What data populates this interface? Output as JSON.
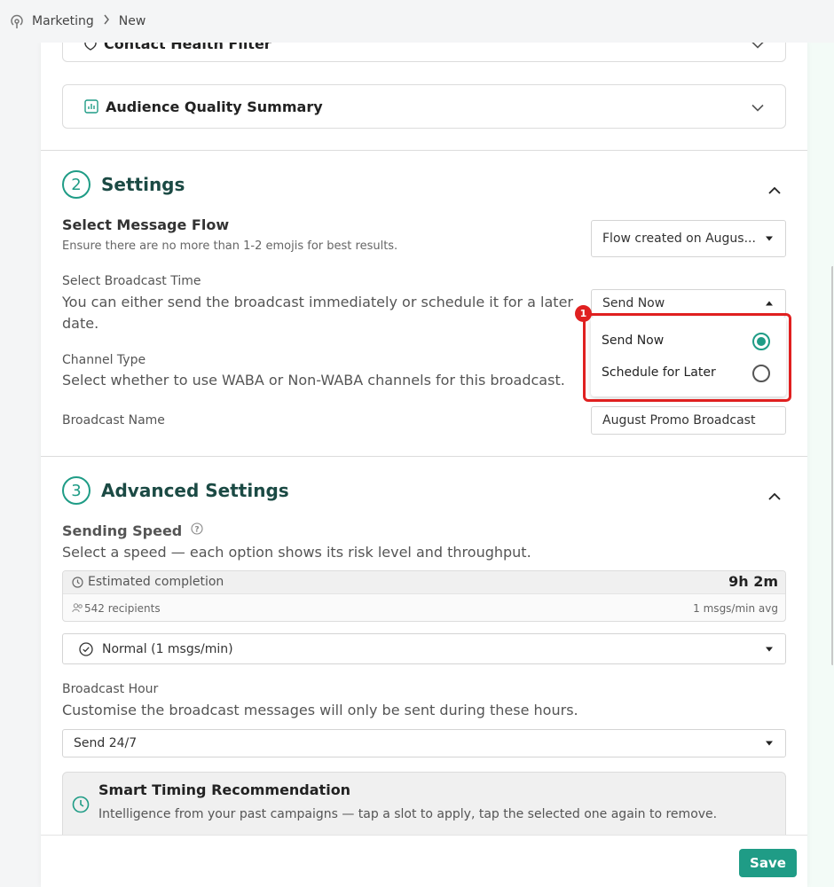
{
  "breadcrumb": {
    "root": "Marketing",
    "current": "New"
  },
  "audience": {
    "contact_health_filter": "Contact Health Filter",
    "audience_quality_summary": "Audience Quality Summary"
  },
  "settings": {
    "step": "2",
    "title": "Settings",
    "message_flow_label": "Select Message Flow",
    "message_flow_desc": "Ensure there are no more than 1-2 emojis for best results.",
    "message_flow_value": "Flow created on Augus...",
    "broadcast_time_label": "Select Broadcast Time",
    "broadcast_time_desc": "You can either send the broadcast immediately or schedule it for a later date.",
    "broadcast_time_value": "Send Now",
    "broadcast_time_options": [
      {
        "label": "Send Now",
        "selected": true
      },
      {
        "label": "Schedule for Later",
        "selected": false
      }
    ],
    "annotation_badge": "1",
    "channel_type_label": "Channel Type",
    "channel_type_desc": "Select whether to use WABA or Non-WABA channels for this broadcast.",
    "broadcast_name_label": "Broadcast Name",
    "broadcast_name_value": "August Promo Broadcast"
  },
  "advanced": {
    "step": "3",
    "title": "Advanced Settings",
    "sending_speed_label": "Sending Speed",
    "sending_speed_desc": "Select a speed — each option shows its risk level and throughput.",
    "estimated_completion_label": "Estimated completion",
    "estimated_completion_value": "9h 2m",
    "recipients": "542 recipients",
    "avg_rate": "1 msgs/min avg",
    "speed_value": "Normal (1 msgs/min)",
    "broadcast_hour_label": "Broadcast Hour",
    "broadcast_hour_desc": "Customise the broadcast messages will only be sent during these hours.",
    "broadcast_hour_value": "Send 24/7",
    "smart_timing_title": "Smart Timing Recommendation",
    "smart_timing_desc": "Intelligence from your past campaigns — tap a slot to apply, tap the selected one again to remove."
  },
  "footer": {
    "save_label": "Save"
  },
  "colors": {
    "accent": "#1f9c86",
    "title_dark": "#1b4a44",
    "annotation_red": "#e02020"
  }
}
